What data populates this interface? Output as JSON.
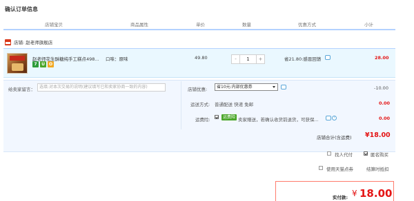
{
  "page": {
    "title": "确认订单信息"
  },
  "columns": [
    "店铺宝贝",
    "商品属性",
    "单价",
    "数量",
    "优惠方式",
    "小计"
  ],
  "shop": {
    "prefix": "店铺:",
    "name": "赵老师旗舰店"
  },
  "item": {
    "title": "赵老师花生酥糖纯手工糕点498...",
    "badges": [
      "7",
      "U",
      "O"
    ],
    "spec": "口味：原味",
    "price": "49.80",
    "minus": "-",
    "quantity": "1",
    "plus": "+",
    "promotion": "省21.80:感恩回馈",
    "subtotal": "28.00"
  },
  "options": {
    "message_label": "给卖家留言：",
    "message_placeholder": "选填:对本次交易的说明(建议填写已和卖家协商一致的内容)",
    "coupon_label": "店铺优惠:",
    "coupon_selected": "省10元:内部优惠券",
    "coupon_amount": "-10.00",
    "shipping_label": "运送方式:",
    "shipping_value": "普通配送 快递 免邮",
    "shipping_amount": "0.00",
    "insurance_label": "运费险:",
    "insurance_badge": "运费险",
    "insurance_text": "卖家赠送，若确认收货前退货，可获保...",
    "insurance_amount": "0.00",
    "qmark": "?"
  },
  "totals": {
    "shop_total_label": "店铺合计(含运费)",
    "shop_total": "¥18.00"
  },
  "extras": {
    "pay_for_other": "找人代付",
    "anonymous": "匿名购买",
    "tmall_points": "使用天猫点券",
    "points_value": "结算时抵扣"
  },
  "payment": {
    "label": "实付款:",
    "currency": "¥",
    "amount": "18.00"
  },
  "colors": {
    "accent": "#e41515",
    "header_line": "#b2d1ff",
    "item_bg": "#eaf8ff",
    "options_bg": "#f2f7ff",
    "pay_border": "#ff7b6b"
  },
  "icons": [
    "shop-icon",
    "chat-icon",
    "dropdown-arrow-icon",
    "question-icon",
    "checkbox-icon"
  ]
}
